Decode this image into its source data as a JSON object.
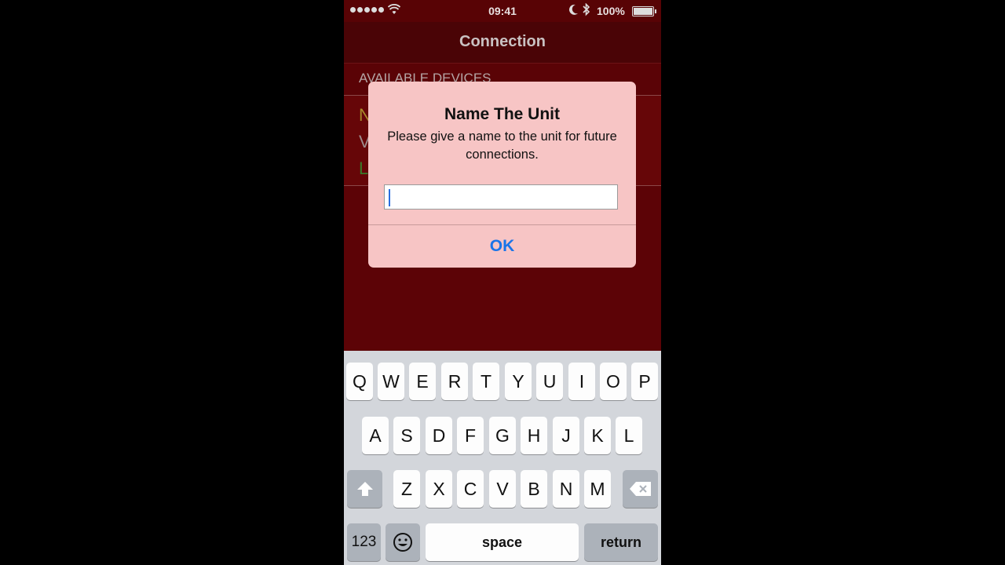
{
  "status_bar": {
    "time": "09:41",
    "battery": "100%"
  },
  "nav": {
    "title": "Connection"
  },
  "section": {
    "header": "AVAILABLE DEVICES"
  },
  "device": {
    "line1": "N",
    "line2": "V",
    "line3": "L"
  },
  "alert": {
    "title": "Name The Unit",
    "message": "Please give a name to the unit for future connections.",
    "input_value": "",
    "ok_label": "OK"
  },
  "keyboard": {
    "row1": [
      "Q",
      "W",
      "E",
      "R",
      "T",
      "Y",
      "U",
      "I",
      "O",
      "P"
    ],
    "row2": [
      "A",
      "S",
      "D",
      "F",
      "G",
      "H",
      "J",
      "K",
      "L"
    ],
    "row3": [
      "Z",
      "X",
      "C",
      "V",
      "B",
      "N",
      "M"
    ],
    "numbers_label": "123",
    "space_label": "space",
    "return_label": "return"
  },
  "colors": {
    "app_background": "#5c0306",
    "alert_background": "#f7c5c5",
    "accent": "#1a74e8"
  }
}
